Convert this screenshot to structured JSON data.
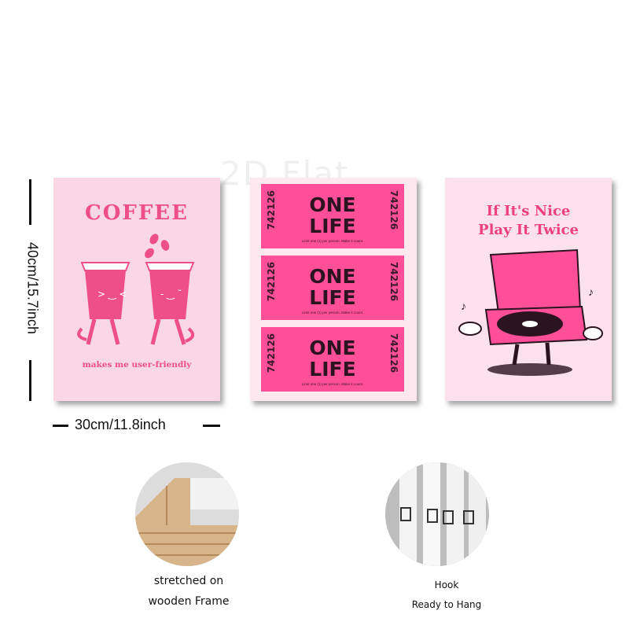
{
  "watermark": "2D Flat",
  "dimensions": {
    "height_label": "40cm/15.7inch",
    "width_label": "30cm/11.8inch"
  },
  "posters": {
    "coffee": {
      "title": "COFFEE",
      "subtitle": "makes me user-friendly",
      "accent": "#ee4f86",
      "icon": "coffee-cups-icon"
    },
    "ticket": {
      "tickets": [
        {
          "line1": "ONE",
          "line2": "LIFE",
          "number": "742126",
          "fine": "Limit one (1) per person. Make it count."
        },
        {
          "line1": "ONE",
          "line2": "LIFE",
          "number": "742126",
          "fine": "Limit one (1) per person. Make it count."
        },
        {
          "line1": "ONE",
          "line2": "LIFE",
          "number": "742126",
          "fine": "Limit one (1) per person. Make it count."
        }
      ],
      "accent": "#ff4f98"
    },
    "vinyl": {
      "title_line1": "If It's Nice",
      "title_line2": "Play It Twice",
      "accent": "#ee3f7e",
      "icon": "record-player-icon"
    }
  },
  "features": {
    "frame": {
      "line1": "stretched on",
      "line2": "wooden Frame",
      "icon": "wooden-frame-icon"
    },
    "hook": {
      "line1": "Hook",
      "line2": "Ready to Hang",
      "icon": "hook-icon"
    }
  }
}
